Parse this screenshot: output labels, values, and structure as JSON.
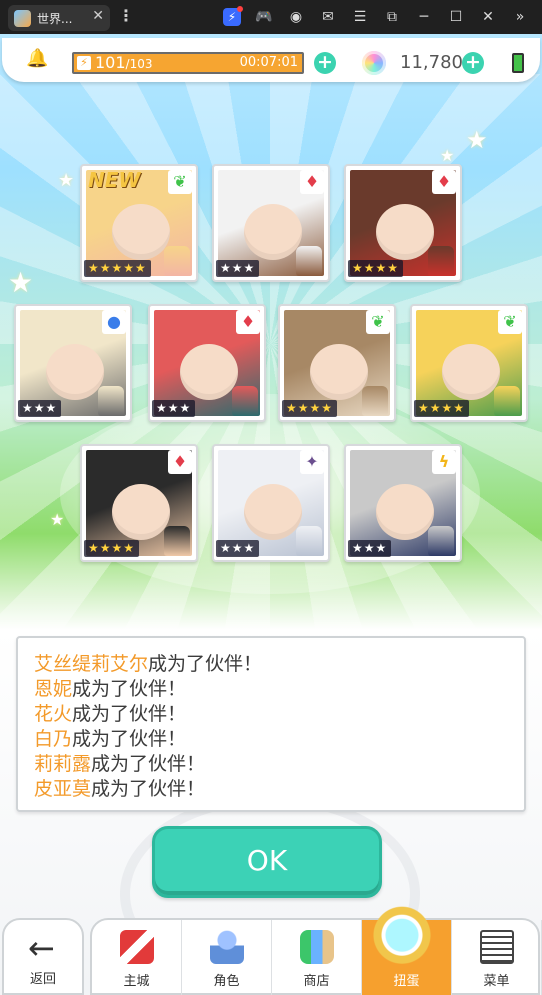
{
  "window": {
    "tab_title": "世界...",
    "tab_close": "✕",
    "more": "⋮",
    "controls": [
      "bolt-icon",
      "gamepad-icon",
      "account-icon",
      "mail-icon",
      "menu-icon",
      "screenshot-icon",
      "minimize-icon",
      "maximize-icon",
      "close-icon",
      "collapse-icon"
    ],
    "control_glyphs": [
      "⚡",
      "🎮",
      "◉",
      "✉",
      "☰",
      "⧉",
      "─",
      "☐",
      "✕",
      "»"
    ]
  },
  "status": {
    "bell_icon": "🔔",
    "stamina_current": "101",
    "stamina_max": "/103",
    "stamina_timer": "00:07:01",
    "stamina_fraction": 0.98,
    "gems": "11,780",
    "plus": "+"
  },
  "cards": [
    {
      "name": "艾丝缇莉艾尔",
      "element": "wind",
      "element_glyph": "❦",
      "stars": "★★★★★",
      "star_level": 5,
      "new": "NEW",
      "colors": [
        "#f7d48a",
        "#f3b5a4"
      ]
    },
    {
      "name": "恩妮",
      "element": "fire",
      "element_glyph": "♦",
      "stars": "★★★",
      "star_level": 3,
      "new": "",
      "colors": [
        "#f2f2f2",
        "#8a5a3c"
      ]
    },
    {
      "name": "花火",
      "element": "fire",
      "element_glyph": "♦",
      "stars": "★★★★",
      "star_level": 4,
      "new": "",
      "colors": [
        "#6a3a2c",
        "#c9322c"
      ]
    },
    {
      "name": "白乃",
      "element": "water",
      "element_glyph": "●",
      "stars": "★★★",
      "star_level": 3,
      "new": "",
      "colors": [
        "#f1e6c9",
        "#6b6b6b"
      ]
    },
    {
      "name": "莉莉露",
      "element": "fire",
      "element_glyph": "♦",
      "stars": "★★★",
      "star_level": 3,
      "new": "",
      "colors": [
        "#e35a5a",
        "#2c6b6e"
      ]
    },
    {
      "name": "皮亚莫",
      "element": "wind",
      "element_glyph": "❦",
      "stars": "★★★★",
      "star_level": 4,
      "new": "",
      "colors": [
        "#a78865",
        "#e8d8c2"
      ]
    },
    {
      "name": "",
      "element": "wind",
      "element_glyph": "❦",
      "stars": "★★★★",
      "star_level": 4,
      "new": "",
      "colors": [
        "#f6d25a",
        "#4c9c4c"
      ]
    },
    {
      "name": "",
      "element": "fire",
      "element_glyph": "♦",
      "stars": "★★★★",
      "star_level": 4,
      "new": "",
      "colors": [
        "#2b2b2b",
        "#f0c9a8"
      ]
    },
    {
      "name": "",
      "element": "dark",
      "element_glyph": "✦",
      "stars": "★★★",
      "star_level": 3,
      "new": "",
      "colors": [
        "#eef0f4",
        "#b9c2d2"
      ]
    },
    {
      "name": "",
      "element": "light",
      "element_glyph": "ϟ",
      "stars": "★★★",
      "star_level": 3,
      "new": "",
      "colors": [
        "#c9c9c9",
        "#2e3a66"
      ]
    }
  ],
  "dialog": {
    "lines": [
      {
        "name": "艾丝缇莉艾尔",
        "text": "成为了伙伴！"
      },
      {
        "name": "恩妮",
        "text": "成为了伙伴！"
      },
      {
        "name": "花火",
        "text": "成为了伙伴！"
      },
      {
        "name": "白乃",
        "text": "成为了伙伴！"
      },
      {
        "name": "莉莉露",
        "text": "成为了伙伴！"
      },
      {
        "name": "皮亚莫",
        "text": "成为了伙伴！"
      }
    ]
  },
  "ok_label": "OK",
  "nav": {
    "back_label": "返回",
    "back_glyph": "←",
    "items": [
      {
        "label": "主城",
        "icon": "castle-icon",
        "active": false
      },
      {
        "label": "角色",
        "icon": "character-icon",
        "active": false
      },
      {
        "label": "商店",
        "icon": "shop-icon",
        "active": false
      },
      {
        "label": "扭蛋",
        "icon": "gacha-icon",
        "active": true
      },
      {
        "label": "菜单",
        "icon": "menu-list-icon",
        "active": false
      }
    ]
  },
  "colors": {
    "accent_teal": "#3cd2b6",
    "orange": "#f6a02e",
    "name_orange": "#f39a2a"
  }
}
